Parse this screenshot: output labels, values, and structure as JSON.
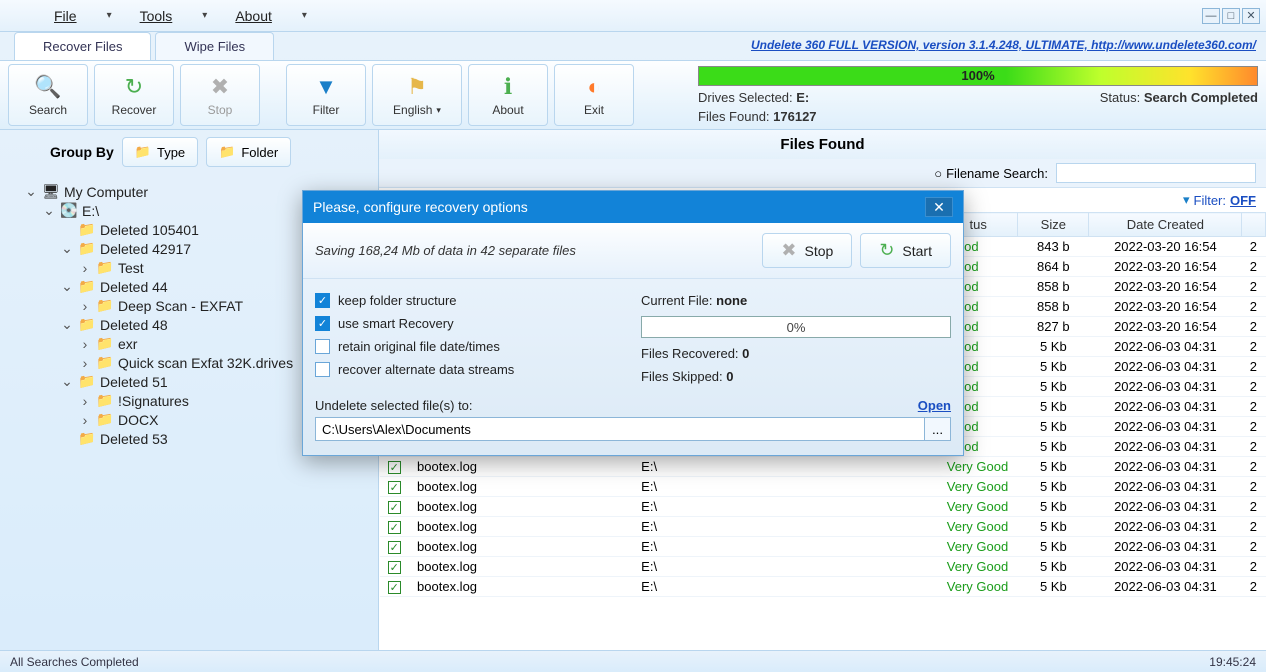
{
  "menu": {
    "file": "File",
    "tools": "Tools",
    "about": "About"
  },
  "version_link": "Undelete 360 FULL VERSION, version 3.1.4.248, ULTIMATE, http://www.undelete360.com/",
  "tabs": {
    "recover": "Recover Files",
    "wipe": "Wipe Files"
  },
  "toolbar": {
    "search": "Search",
    "recover": "Recover",
    "stop": "Stop",
    "filter": "Filter",
    "english": "English",
    "about": "About",
    "exit": "Exit"
  },
  "scan": {
    "percent": "100%",
    "drives_label": "Drives Selected: ",
    "drives_value": "E:",
    "files_label": "Files Found: ",
    "files_value": "176127",
    "status_label": "Status: ",
    "status_value": "Search Completed"
  },
  "groupby": {
    "label": "Group By",
    "type": "Type",
    "folder": "Folder"
  },
  "tree": {
    "root": "My Computer",
    "drive": "E:\\",
    "nodes": [
      {
        "label": "Deleted 105401",
        "children": []
      },
      {
        "label": "Deleted 42917",
        "children": [
          {
            "label": "Test"
          }
        ]
      },
      {
        "label": "Deleted 44",
        "children": [
          {
            "label": "Deep Scan - EXFAT"
          }
        ]
      },
      {
        "label": "Deleted 48",
        "children": [
          {
            "label": "exr"
          },
          {
            "label": "Quick scan Exfat 32K.drives"
          }
        ]
      },
      {
        "label": "Deleted 51",
        "children": [
          {
            "label": "!Signatures"
          },
          {
            "label": "DOCX"
          }
        ]
      },
      {
        "label": "Deleted 53",
        "children": []
      }
    ]
  },
  "files_panel": {
    "title": "Files Found",
    "filename_search_label": "Filename Search:",
    "filter_label": "Filter:",
    "filter_value": "OFF",
    "columns": {
      "status": "tus",
      "size": "Size",
      "date": "Date Created"
    },
    "rows": [
      {
        "name": "",
        "folder": "",
        "status": "Good",
        "size": "843 b",
        "date": "2022-03-20 16:54",
        "tail": "2"
      },
      {
        "name": "",
        "folder": "",
        "status": "Good",
        "size": "864 b",
        "date": "2022-03-20 16:54",
        "tail": "2"
      },
      {
        "name": "",
        "folder": "",
        "status": "Good",
        "size": "858 b",
        "date": "2022-03-20 16:54",
        "tail": "2"
      },
      {
        "name": "",
        "folder": "",
        "status": "Good",
        "size": "858 b",
        "date": "2022-03-20 16:54",
        "tail": "2"
      },
      {
        "name": "",
        "folder": "",
        "status": "Good",
        "size": "827 b",
        "date": "2022-03-20 16:54",
        "tail": "2"
      },
      {
        "name": "",
        "folder": "",
        "status": "Good",
        "size": "5 Kb",
        "date": "2022-06-03 04:31",
        "tail": "2"
      },
      {
        "name": "",
        "folder": "",
        "status": "Good",
        "size": "5 Kb",
        "date": "2022-06-03 04:31",
        "tail": "2"
      },
      {
        "name": "",
        "folder": "",
        "status": "Good",
        "size": "5 Kb",
        "date": "2022-06-03 04:31",
        "tail": "2"
      },
      {
        "name": "",
        "folder": "",
        "status": "Good",
        "size": "5 Kb",
        "date": "2022-06-03 04:31",
        "tail": "2"
      },
      {
        "name": "",
        "folder": "",
        "status": "Good",
        "size": "5 Kb",
        "date": "2022-06-03 04:31",
        "tail": "2"
      },
      {
        "name": "",
        "folder": "",
        "status": "Good",
        "size": "5 Kb",
        "date": "2022-06-03 04:31",
        "tail": "2"
      },
      {
        "name": "bootex.log",
        "folder": "E:\\",
        "status": "Very Good",
        "size": "5 Kb",
        "date": "2022-06-03 04:31",
        "tail": "2"
      },
      {
        "name": "bootex.log",
        "folder": "E:\\",
        "status": "Very Good",
        "size": "5 Kb",
        "date": "2022-06-03 04:31",
        "tail": "2"
      },
      {
        "name": "bootex.log",
        "folder": "E:\\",
        "status": "Very Good",
        "size": "5 Kb",
        "date": "2022-06-03 04:31",
        "tail": "2"
      },
      {
        "name": "bootex.log",
        "folder": "E:\\",
        "status": "Very Good",
        "size": "5 Kb",
        "date": "2022-06-03 04:31",
        "tail": "2"
      },
      {
        "name": "bootex.log",
        "folder": "E:\\",
        "status": "Very Good",
        "size": "5 Kb",
        "date": "2022-06-03 04:31",
        "tail": "2"
      },
      {
        "name": "bootex.log",
        "folder": "E:\\",
        "status": "Very Good",
        "size": "5 Kb",
        "date": "2022-06-03 04:31",
        "tail": "2"
      },
      {
        "name": "bootex.log",
        "folder": "E:\\",
        "status": "Very Good",
        "size": "5 Kb",
        "date": "2022-06-03 04:31",
        "tail": "2"
      }
    ]
  },
  "modal": {
    "title": "Please, configure recovery options",
    "saving": "Saving 168,24 Mb of data in 42 separate files",
    "stop": "Stop",
    "start": "Start",
    "opts": {
      "keep": "keep folder structure",
      "smart": "use smart Recovery",
      "retain": "retain original file date/times",
      "ads": "recover alternate data streams"
    },
    "current_file_label": "Current File: ",
    "current_file_value": "none",
    "progress": "0%",
    "recovered_label": "Files Recovered: ",
    "recovered_value": "0",
    "skipped_label": "Files Skipped: ",
    "skipped_value": "0",
    "dest_label": "Undelete selected file(s) to:",
    "open": "Open",
    "dest_path": "C:\\Users\\Alex\\Documents",
    "browse": "..."
  },
  "statusbar": {
    "text": "All Searches Completed",
    "time": "19:45:24"
  }
}
